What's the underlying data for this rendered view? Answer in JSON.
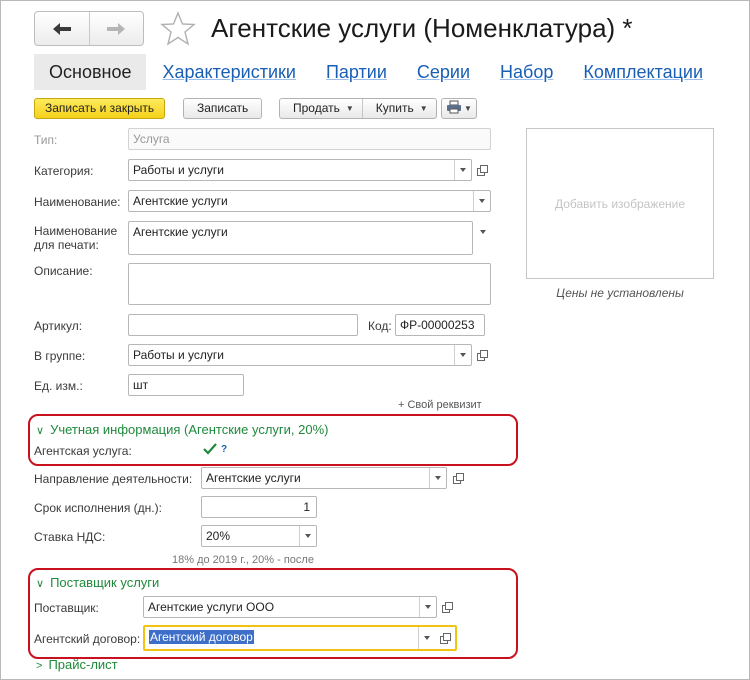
{
  "window": {
    "title": "Агентские услуги (Номенклатура) *"
  },
  "tabs": [
    "Основное",
    "Характеристики",
    "Партии",
    "Серии",
    "Набор",
    "Комплектации"
  ],
  "toolbar": {
    "save_close": "Записать и закрыть",
    "save": "Записать",
    "sell": "Продать",
    "buy": "Купить"
  },
  "form": {
    "type_label": "Тип:",
    "type_value": "Услуга",
    "category_label": "Категория:",
    "category_value": "Работы и услуги",
    "name_label": "Наименование:",
    "name_value": "Агентские услуги",
    "print_name_label_1": "Наименование",
    "print_name_label_2": "для печати:",
    "print_name_value": "Агентские услуги",
    "description_label": "Описание:",
    "description_value": "",
    "article_label": "Артикул:",
    "article_value": "",
    "code_label": "Код:",
    "code_value": "ФР-00000253",
    "group_label": "В группе:",
    "group_value": "Работы и услуги",
    "unit_label": "Ед. изм.:",
    "unit_value": "шт",
    "custom_attr_link": "+ Свой реквизит"
  },
  "image_panel": {
    "add_image": "Добавить изображение",
    "prices": "Цены не установлены"
  },
  "accounting": {
    "header": "Учетная информация (Агентские услуги, 20%)",
    "agent_service_label": "Агентская услуга:",
    "agent_service_checked": true,
    "help": "?",
    "activity_label": "Направление деятельности:",
    "activity_value": "Агентские услуги",
    "term_label": "Срок исполнения (дн.):",
    "term_value": "1",
    "vat_label": "Ставка НДС:",
    "vat_value": "20%",
    "vat_hint": "18% до 2019 г., 20% - после"
  },
  "supplier": {
    "header": "Поставщик услуги",
    "supplier_label": "Поставщик:",
    "supplier_value": "Агентские услуги ООО",
    "contract_label": "Агентский договор:",
    "contract_value": "Агентский договор"
  },
  "pricelist": {
    "header": "Прайс-лист"
  },
  "colors": {
    "accent_green": "#1e8a3c",
    "link_blue": "#1a5fb4",
    "highlight_red": "#c8101e",
    "primary_button_yellow": "#f5d11b"
  }
}
